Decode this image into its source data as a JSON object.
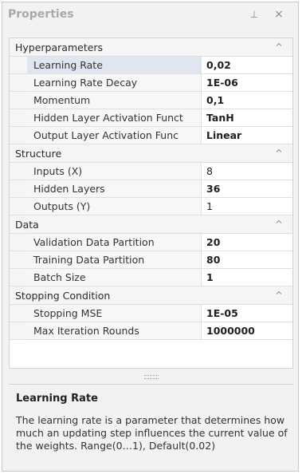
{
  "panel": {
    "title": "Properties",
    "pin_glyph": "⊥",
    "close_glyph": "×"
  },
  "categories": [
    {
      "label": "Hyperparameters",
      "rows": [
        {
          "name": "Learning Rate",
          "value": "0,02",
          "bold": true,
          "selected": true
        },
        {
          "name": "Learning Rate Decay",
          "value": "1E-06",
          "bold": true,
          "selected": false
        },
        {
          "name": "Momentum",
          "value": "0,1",
          "bold": true,
          "selected": false
        },
        {
          "name": "Hidden Layer Activation Funct",
          "value": "TanH",
          "bold": true,
          "selected": false
        },
        {
          "name": "Output Layer Activation Func",
          "value": "Linear",
          "bold": true,
          "selected": false
        }
      ]
    },
    {
      "label": "Structure",
      "rows": [
        {
          "name": "Inputs (X)",
          "value": "8",
          "bold": false,
          "selected": false
        },
        {
          "name": "Hidden Layers",
          "value": "36",
          "bold": true,
          "selected": false
        },
        {
          "name": "Outputs (Y)",
          "value": "1",
          "bold": false,
          "selected": false
        }
      ]
    },
    {
      "label": "Data",
      "rows": [
        {
          "name": "Validation Data Partition",
          "value": "20",
          "bold": true,
          "selected": false
        },
        {
          "name": "Training Data Partition",
          "value": "80",
          "bold": true,
          "selected": false
        },
        {
          "name": "Batch Size",
          "value": "1",
          "bold": true,
          "selected": false
        }
      ]
    },
    {
      "label": "Stopping Condition",
      "rows": [
        {
          "name": "Stopping MSE",
          "value": "1E-05",
          "bold": true,
          "selected": false
        },
        {
          "name": "Max Iteration Rounds",
          "value": "1000000",
          "bold": true,
          "selected": false
        }
      ]
    }
  ],
  "description": {
    "title": "Learning Rate",
    "text": "The learning rate is a parameter that determines how much an updating step influences the current value of the weights. Range(0…1), Default(0.02)"
  },
  "icons": {
    "pin": "pin-icon",
    "close": "close-icon",
    "collapse": "chevron-up-icon"
  }
}
